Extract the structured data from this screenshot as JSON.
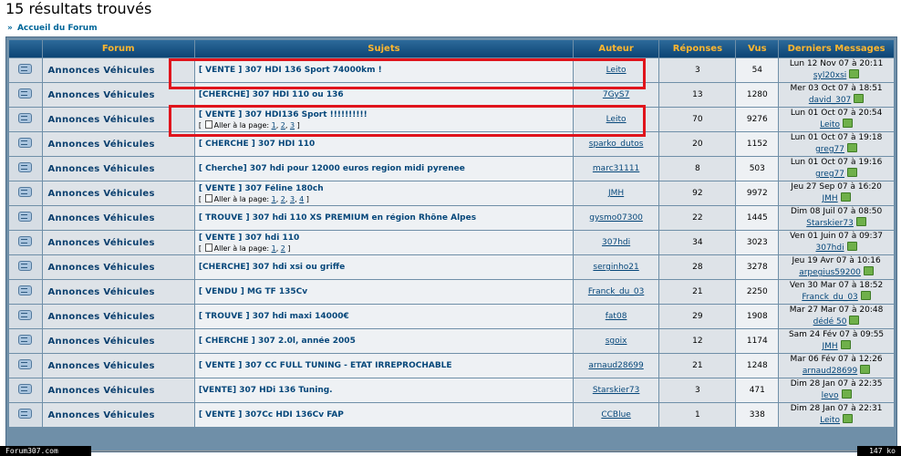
{
  "page": {
    "title": "15 résultats trouvés",
    "breadcrumb": "Accueil du Forum",
    "breadcrumb_arrow": "»"
  },
  "headers": {
    "forum": "Forum",
    "sujets": "Sujets",
    "auteur": "Auteur",
    "reponses": "Réponses",
    "vus": "Vus",
    "derniers": "Derniers Messages"
  },
  "goto_label": "Aller à la page:",
  "rows": [
    {
      "forum": "Annonces Véhicules",
      "subject": "[ VENTE ] 307 HDI 136 Sport 74000km !",
      "pages": [],
      "author": "Leito",
      "replies": "3",
      "views": "54",
      "last_date": "Lun 12 Nov 07 à 20:11",
      "last_user": "syl20xsi"
    },
    {
      "forum": "Annonces Véhicules",
      "subject": "[CHERCHE] 307 HDI 110 ou 136",
      "pages": [],
      "author": "7GyS7",
      "replies": "13",
      "views": "1280",
      "last_date": "Mer 03 Oct 07 à 18:51",
      "last_user": "david_307"
    },
    {
      "forum": "Annonces Véhicules",
      "subject": "[ VENTE ] 307 HDI136 Sport !!!!!!!!!!",
      "pages": [
        "1",
        "2",
        "3"
      ],
      "author": "Leito",
      "replies": "70",
      "views": "9276",
      "last_date": "Lun 01 Oct 07 à 20:54",
      "last_user": "Leito"
    },
    {
      "forum": "Annonces Véhicules",
      "subject": "[ CHERCHE ] 307 HDI 110",
      "pages": [],
      "author": "sparko_dutos",
      "replies": "20",
      "views": "1152",
      "last_date": "Lun 01 Oct 07 à 19:18",
      "last_user": "greg77"
    },
    {
      "forum": "Annonces Véhicules",
      "subject": "[ Cherche] 307 hdi pour 12000 euros region midi pyrenee",
      "pages": [],
      "author": "marc31111",
      "replies": "8",
      "views": "503",
      "last_date": "Lun 01 Oct 07 à 19:16",
      "last_user": "greg77"
    },
    {
      "forum": "Annonces Véhicules",
      "subject": "[ VENTE ] 307 Féline 180ch",
      "pages": [
        "1",
        "2",
        "3",
        "4"
      ],
      "author": "JMH",
      "replies": "92",
      "views": "9972",
      "last_date": "Jeu 27 Sep 07 à 16:20",
      "last_user": "JMH"
    },
    {
      "forum": "Annonces Véhicules",
      "subject": "[ TROUVE ] 307 hdi 110 XS PREMIUM en région Rhône Alpes",
      "pages": [],
      "author": "gysmo07300",
      "replies": "22",
      "views": "1445",
      "last_date": "Dim 08 Juil 07 à 08:50",
      "last_user": "Starskier73"
    },
    {
      "forum": "Annonces Véhicules",
      "subject": "[ VENTE ] 307 hdi 110",
      "pages": [
        "1",
        "2"
      ],
      "author": "307hdi",
      "replies": "34",
      "views": "3023",
      "last_date": "Ven 01 Juin 07 à 09:37",
      "last_user": "307hdi"
    },
    {
      "forum": "Annonces Véhicules",
      "subject": "[CHERCHE] 307 hdi xsi ou griffe",
      "pages": [],
      "author": "serginho21",
      "replies": "28",
      "views": "3278",
      "last_date": "Jeu 19 Avr 07 à 10:16",
      "last_user": "arpegius59200"
    },
    {
      "forum": "Annonces Véhicules",
      "subject": "[ VENDU ] MG TF 135Cv",
      "pages": [],
      "author": "Franck_du_03",
      "replies": "21",
      "views": "2250",
      "last_date": "Ven 30 Mar 07 à 18:52",
      "last_user": "Franck_du_03"
    },
    {
      "forum": "Annonces Véhicules",
      "subject": "[ TROUVE ] 307 hdi maxi 14000€",
      "pages": [],
      "author": "fat08",
      "replies": "29",
      "views": "1908",
      "last_date": "Mar 27 Mar 07 à 20:48",
      "last_user": "dédé 50"
    },
    {
      "forum": "Annonces Véhicules",
      "subject": "[ CHERCHE ] 307 2.0l, année 2005",
      "pages": [],
      "author": "sgoix",
      "replies": "12",
      "views": "1174",
      "last_date": "Sam 24 Fév 07 à 09:55",
      "last_user": "JMH"
    },
    {
      "forum": "Annonces Véhicules",
      "subject": "[ VENTE ] 307 CC FULL TUNING - ETAT IRREPROCHABLE",
      "pages": [],
      "author": "arnaud28699",
      "replies": "21",
      "views": "1248",
      "last_date": "Mar 06 Fév 07 à 12:26",
      "last_user": "arnaud28699"
    },
    {
      "forum": "Annonces Véhicules",
      "subject": "[VENTE] 307 HDi 136 Tuning.",
      "pages": [],
      "author": "Starskier73",
      "replies": "3",
      "views": "471",
      "last_date": "Dim 28 Jan 07 à 22:35",
      "last_user": "levo"
    },
    {
      "forum": "Annonces Véhicules",
      "subject": "[ VENTE ] 307Cc HDI 136Cv FAP",
      "pages": [],
      "author": "CCBlue",
      "replies": "1",
      "views": "338",
      "last_date": "Dim 28 Jan 07 à 22:31",
      "last_user": "Leito"
    }
  ],
  "footer": {
    "site": "Forum307.com",
    "size": "147 ko"
  },
  "colors": {
    "header_bg": "#0c4474",
    "header_text": "#ffb62e",
    "highlight": "#e0141c"
  }
}
